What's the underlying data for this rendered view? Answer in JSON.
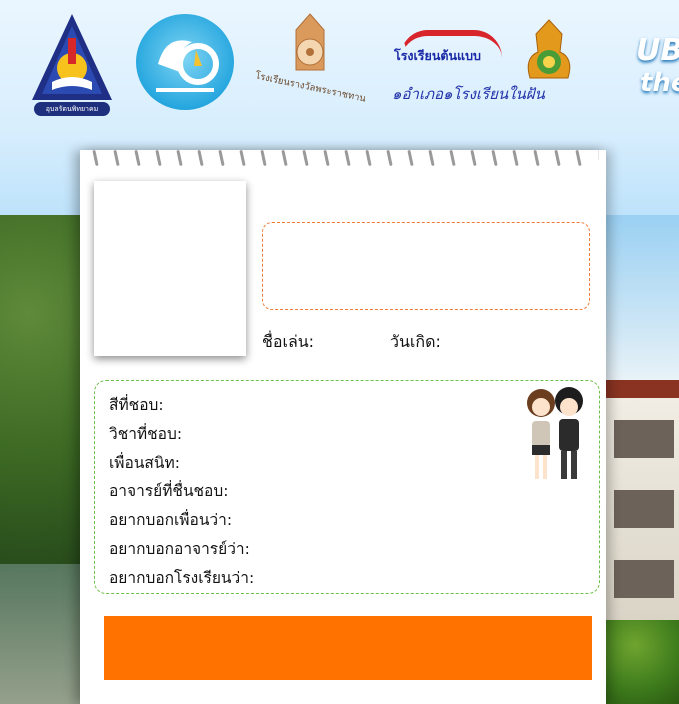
{
  "header": {
    "headline_line1": "UB",
    "headline_line2": "the",
    "logos": [
      {
        "name": "school-emblem",
        "caption": "อุบลรัตนพิทยาคม"
      },
      {
        "name": "anniversary-emblem"
      },
      {
        "name": "royal-award-emblem",
        "caption": "โรงเรียนรางวัลพระราชทาน"
      },
      {
        "name": "model-school-emblem",
        "top": "โรงเรียนต้นแบบ",
        "bottom": "๑อำเภอ๑โรงเรียนในฝัน"
      },
      {
        "name": "obec-emblem"
      }
    ]
  },
  "card": {
    "nickname_label": "ชื่อเล่น:",
    "birthday_label": "วันเกิด:",
    "info_fields": [
      "สีที่ชอบ:",
      "วิชาที่ชอบ:",
      "เพื่อนสนิท:",
      "อาจารย์ที่ชื่นชอบ:",
      "อยากบอกเพื่อนว่า:",
      "อยากบอกอาจารย์ว่า:",
      "อยากบอกโรงเรียนว่า:"
    ]
  },
  "colors": {
    "accent_orange": "#ff7200",
    "dashed_orange": "#ef7a36",
    "dashed_green": "#6cc047"
  }
}
